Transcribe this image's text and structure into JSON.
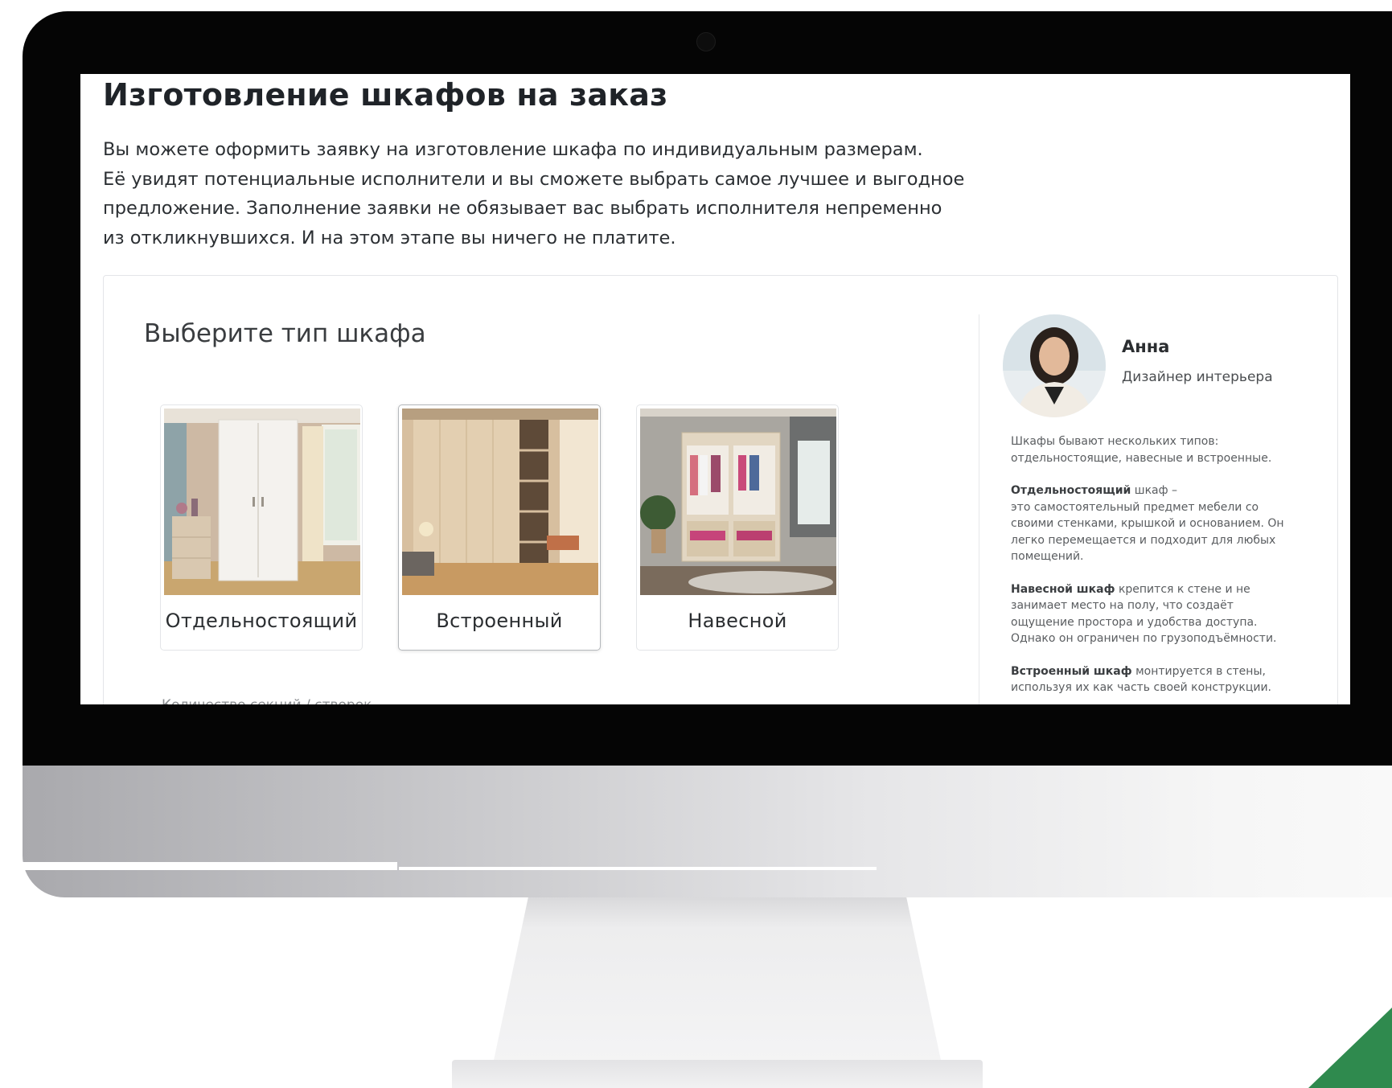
{
  "page": {
    "title": "Изготовление шкафов на заказ",
    "intro": {
      "line1": "Вы можете оформить заявку на изготовление шкафа по индивидуальным размерам.",
      "line2": "Её увидят потенциальные исполнители и вы сможете выбрать самое лучшее и выгодное",
      "line3": "предложение. Заполнение заявки не обязывает вас выбрать исполнителя непременно",
      "line4": "из откликнувшихся. И на этом этапе вы ничего не платите."
    }
  },
  "selector": {
    "heading": "Выберите тип шкафа",
    "options": [
      {
        "label": "Отдельностоящий",
        "selected": false
      },
      {
        "label": "Встроенный",
        "selected": true
      },
      {
        "label": "Навесной",
        "selected": false
      }
    ],
    "next_field_label": "Количество секций / створок"
  },
  "advisor": {
    "name": "Анна",
    "role": "Дизайнер интерьера",
    "intro": "Шкафы бывают нескольких типов: отдельностоящие, навесные и встроенные.",
    "freestanding_title": "Отдельностоящий",
    "freestanding_title_rest": " шкаф –",
    "freestanding_text": "это самостоятельный предмет мебели со своими стенками, крышкой и основанием. Он легко перемещается и подходит для любых помещений.",
    "wall_title": "Навесной шкаф",
    "wall_text": " крепится к стене и не занимает место на полу, что создаёт ощущение простора и удобства доступа. Однако он ограничен по грузоподъёмности.",
    "builtin_title": "Встроенный шкаф",
    "builtin_text": " монтируется в стены, используя их как часть своей конструкции."
  },
  "colors": {
    "accent_green": "#2f8a4e",
    "bezel": "#050505",
    "text_dark": "#1f2328"
  }
}
